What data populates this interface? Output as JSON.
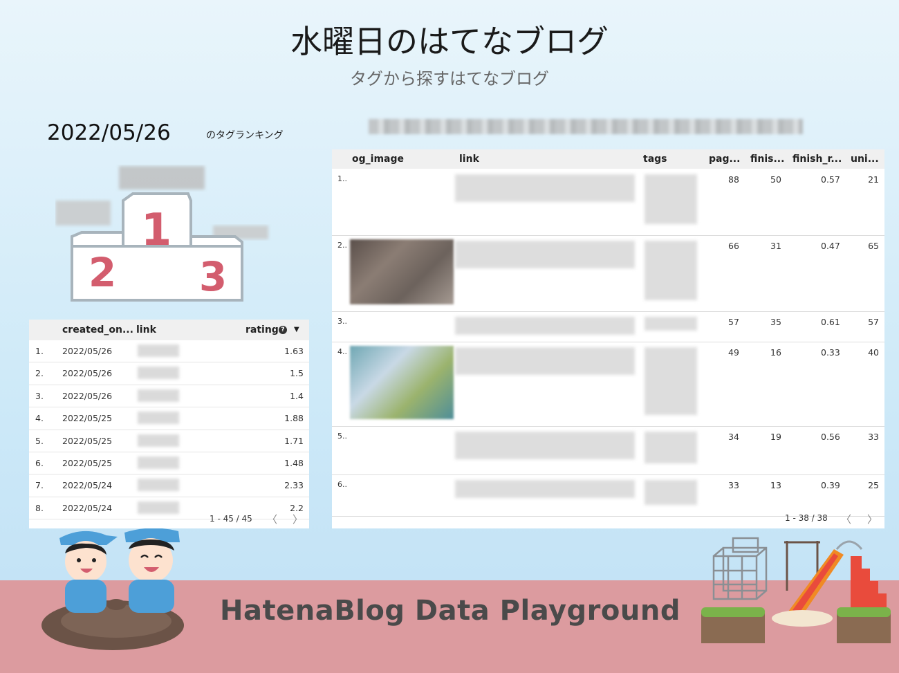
{
  "header": {
    "title": "水曜日のはてなブログ",
    "subtitle": "タグから探すはてなブログ"
  },
  "ranking": {
    "date": "2022/05/26",
    "suffix": "のタグランキング"
  },
  "left_table": {
    "columns": [
      "created_on...",
      "link",
      "rating"
    ],
    "rows": [
      {
        "num": "1.",
        "created_on": "2022/05/26",
        "rating": "1.63"
      },
      {
        "num": "2.",
        "created_on": "2022/05/26",
        "rating": "1.5"
      },
      {
        "num": "3.",
        "created_on": "2022/05/26",
        "rating": "1.4"
      },
      {
        "num": "4.",
        "created_on": "2022/05/25",
        "rating": "1.88"
      },
      {
        "num": "5.",
        "created_on": "2022/05/25",
        "rating": "1.71"
      },
      {
        "num": "6.",
        "created_on": "2022/05/25",
        "rating": "1.48"
      },
      {
        "num": "7.",
        "created_on": "2022/05/24",
        "rating": "2.33"
      },
      {
        "num": "8.",
        "created_on": "2022/05/24",
        "rating": "2.2"
      }
    ],
    "pagination": "1 - 45 / 45",
    "help_glyph": "?",
    "sort_glyph": "▼",
    "prev_glyph": "〈",
    "next_glyph": "〉"
  },
  "right_table": {
    "columns": [
      "og_image",
      "link",
      "tags",
      "pag...",
      "finis...",
      "finish_r...",
      "uni..."
    ],
    "rows": [
      {
        "num": "1..",
        "pag": "88",
        "finis": "50",
        "finish_r": "0.57",
        "uni": "21"
      },
      {
        "num": "2..",
        "pag": "66",
        "finis": "31",
        "finish_r": "0.47",
        "uni": "65"
      },
      {
        "num": "3..",
        "pag": "57",
        "finis": "35",
        "finish_r": "0.61",
        "uni": "57"
      },
      {
        "num": "4..",
        "pag": "49",
        "finis": "16",
        "finish_r": "0.33",
        "uni": "40"
      },
      {
        "num": "5..",
        "pag": "34",
        "finis": "19",
        "finish_r": "0.56",
        "uni": "33"
      },
      {
        "num": "6..",
        "pag": "33",
        "finis": "13",
        "finish_r": "0.39",
        "uni": "25"
      }
    ],
    "pagination": "1 - 38 / 38",
    "prev_glyph": "〈",
    "next_glyph": "〉"
  },
  "podium": {
    "first": "1",
    "second": "2",
    "third": "3"
  },
  "footer": {
    "title": "HatenaBlog Data Playground"
  },
  "colors": {
    "footer_band": "#dc9b9f",
    "podium_number": "#d35d6e",
    "podium_outline": "#a8b4bc"
  }
}
